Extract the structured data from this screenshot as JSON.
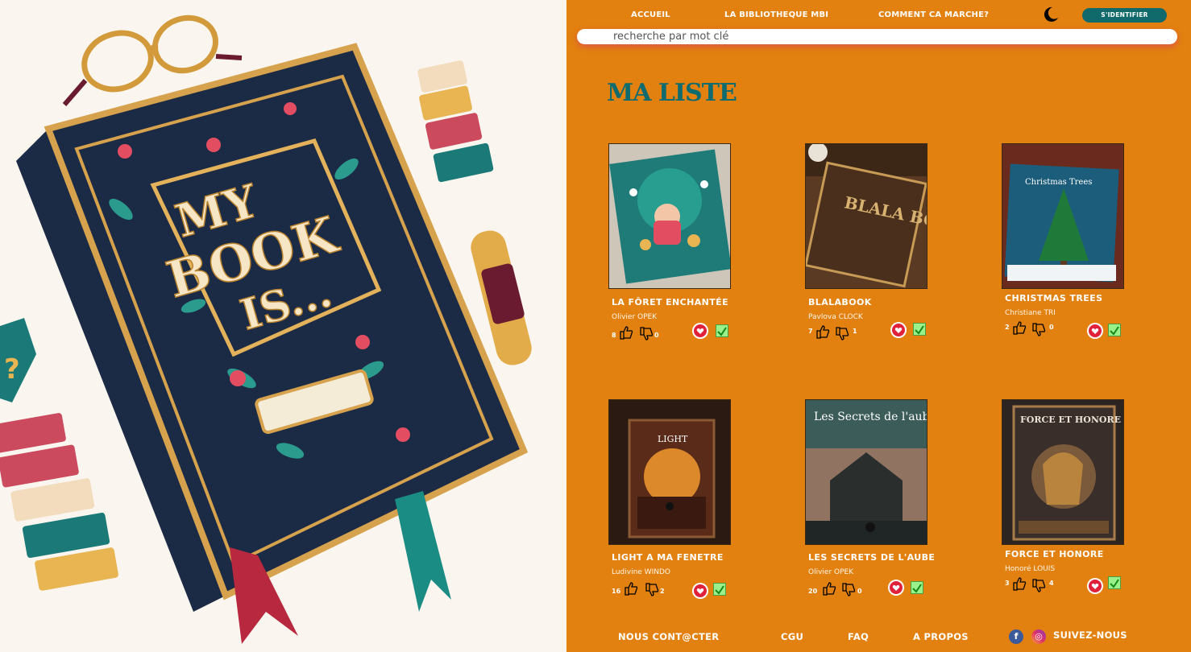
{
  "nav": {
    "home": "ACCUEIL",
    "library": "LA BIBLIOTHEQUE MBI",
    "how": "COMMENT CA MARCHE?",
    "login": "S'IDENTIFIER"
  },
  "search": {
    "placeholder": "recherche par mot clé"
  },
  "hero": {
    "book_title_lines": [
      "MY",
      "BOOK",
      "IS..."
    ]
  },
  "page_title": "MA LISTE",
  "books": [
    {
      "title": "LA FÔRET ENCHANTÉE",
      "author": "Olivier OPEK",
      "likes": "8",
      "dislikes": "0",
      "cover_text": ""
    },
    {
      "title": "BLALABOOK",
      "author": "Pavlova CLOCK",
      "likes": "7",
      "dislikes": "1",
      "cover_text": "BLALA BOOK"
    },
    {
      "title": "CHRISTMAS TREES",
      "author": "Christiane TRI",
      "likes": "2",
      "dislikes": "0",
      "cover_text": "Christmas Trees"
    },
    {
      "title": "LIGHT A MA FENETRE",
      "author": "Ludivine WINDO",
      "likes": "16",
      "dislikes": "2",
      "cover_text": "LIGHT"
    },
    {
      "title": "LES SECRETS DE L'AUBE",
      "author": "Olivier OPEK",
      "likes": "20",
      "dislikes": "0",
      "cover_text": "Les Secrets de l'aube"
    },
    {
      "title": "FORCE ET HONORE",
      "author": "Honoré LOUIS",
      "likes": "3",
      "dislikes": "4",
      "cover_text": "FORCE ET HONORE"
    }
  ],
  "footer": {
    "contact": "NOUS CONT@CTER",
    "cgu": "CGU",
    "faq": "FAQ",
    "about": "A PROPOS",
    "follow": "SUIVEZ-NOUS"
  },
  "colors": {
    "background": "#e2810f",
    "accent_teal": "#0f6b6e",
    "heart": "#e0213a",
    "check": "#9af089"
  },
  "icons": [
    "moon-icon",
    "thumb-up-icon",
    "thumb-down-icon",
    "heart-icon",
    "check-icon",
    "facebook-icon",
    "instagram-icon"
  ]
}
